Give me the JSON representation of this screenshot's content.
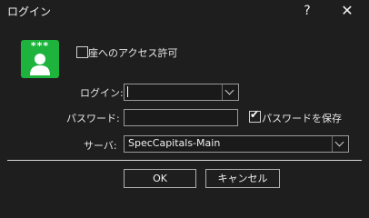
{
  "window": {
    "title": "ログイン",
    "help_glyph": "?",
    "close_glyph": "✕"
  },
  "logo": {
    "stars": "***"
  },
  "account_access": {
    "label": "座へのアクセス許可",
    "checked": false
  },
  "form": {
    "login_label": "ログイン:",
    "login_value": "",
    "password_label": "パスワード:",
    "password_value": "",
    "save_password_label": "パスワードを保存",
    "save_password_checked": true,
    "server_label": "サーバ:",
    "server_value": "SpecCapitals-Main"
  },
  "buttons": {
    "ok": "OK",
    "cancel": "キャンセル"
  }
}
